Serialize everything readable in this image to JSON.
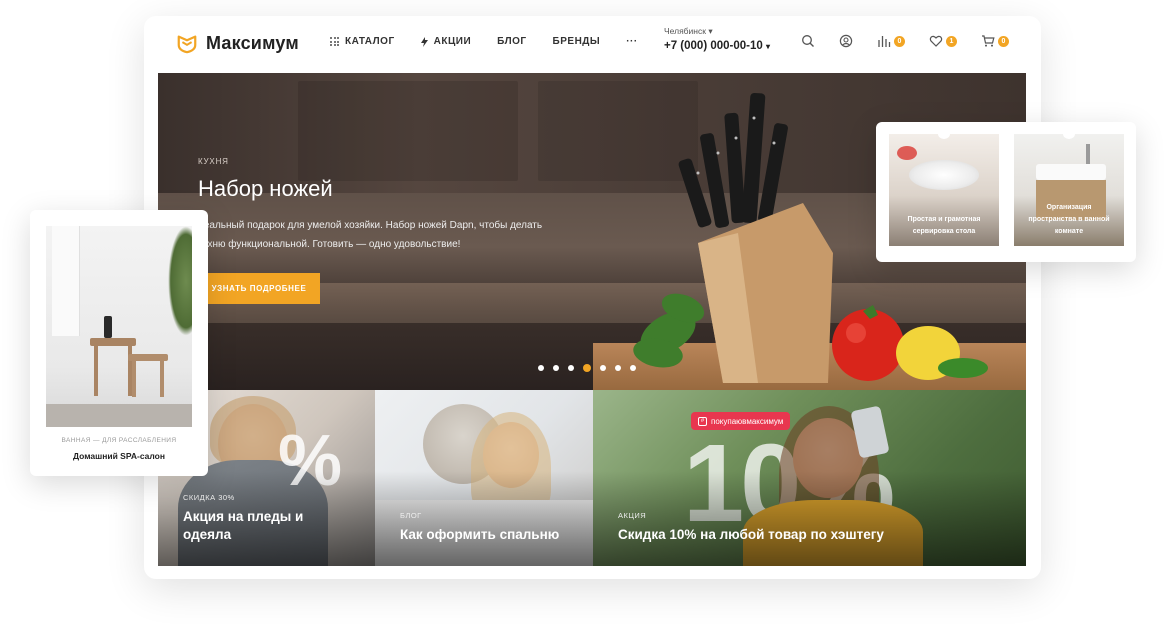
{
  "header": {
    "logo_text": "Максимум",
    "nav": {
      "catalog": "КАТАЛОГ",
      "sales": "АКЦИИ",
      "blog": "БЛОГ",
      "brands": "БРЕНДЫ",
      "more": "···"
    },
    "city": "Челябинск",
    "phone": "+7 (000) 000-00-10",
    "icons": [
      "search-icon",
      "user-icon",
      "compare-icon",
      "heart-icon",
      "cart-icon"
    ],
    "badges": {
      "compare": "0",
      "favorites": "1",
      "cart": "0"
    }
  },
  "hero": {
    "category": "КУХНЯ",
    "title": "Набор ножей",
    "description": "деальный подарок для умелой хозяйки. Набор ножей Dapn, чтобы делать кухню функциональной. Готовить — одно удовольствие!",
    "button_label": "УЗНАТЬ ПОДРОБНЕЕ",
    "slides_count": 7,
    "active_slide": 4
  },
  "tiles": [
    {
      "category": "СКИДКА 30%",
      "title": "Акция на пледы и одеяла",
      "overlay": "%"
    },
    {
      "category": "БЛОГ",
      "title": "Как оформить спальню"
    },
    {
      "category": "АКЦИЯ",
      "title": "Скидка 10% на любой товар по хэштегу",
      "hashtag": "покупаювмаксимум",
      "overlay": "10%"
    }
  ],
  "left_card": {
    "category": "ВАННАЯ — ДЛЯ РАССЛАБЛЕНИЯ",
    "title": "Домашний SPA-салон"
  },
  "right_cards": [
    {
      "title": "Простая и грамотная сервировка стола"
    },
    {
      "title": "Организация пространства в ванной комнате"
    }
  ],
  "colors": {
    "accent": "#f2a524",
    "text": "#222222",
    "badge": "#f2a524"
  }
}
